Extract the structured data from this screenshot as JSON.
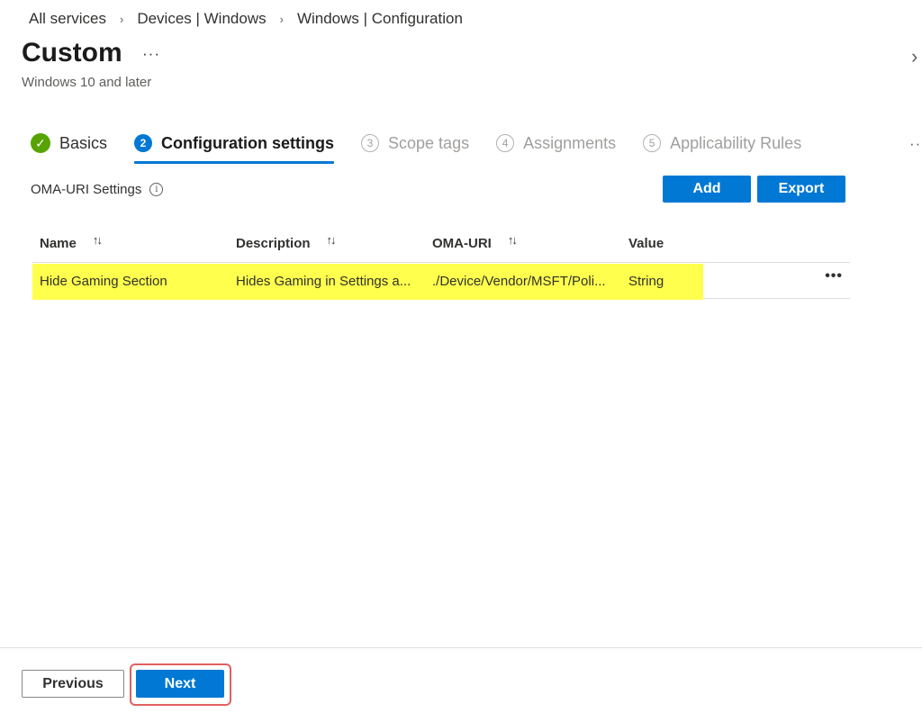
{
  "breadcrumb": [
    "All services",
    "Devices | Windows",
    "Windows | Configuration"
  ],
  "breadcrumb_separator": "›",
  "header": {
    "title": "Custom",
    "more": "···",
    "subtitle": "Windows 10 and later",
    "expand_icon": "›"
  },
  "steps": [
    {
      "number": "",
      "label": "Basics",
      "state": "done"
    },
    {
      "number": "2",
      "label": "Configuration settings",
      "state": "active"
    },
    {
      "number": "3",
      "label": "Scope tags",
      "state": "pending"
    },
    {
      "number": "4",
      "label": "Assignments",
      "state": "pending"
    },
    {
      "number": "5",
      "label": "Applicability Rules",
      "state": "pending"
    }
  ],
  "steps_more": "···",
  "section": {
    "label": "OMA-URI Settings",
    "info_icon": "i"
  },
  "toolbar": {
    "add_label": "Add",
    "export_label": "Export"
  },
  "table": {
    "columns": [
      "Name",
      "Description",
      "OMA-URI",
      "Value"
    ],
    "sort_icon": "↑↓",
    "rows": [
      {
        "name": "Hide Gaming Section",
        "description": "Hides Gaming in Settings a...",
        "oma_uri": "./Device/Vendor/MSFT/Poli...",
        "value": "String",
        "more": "•••"
      }
    ]
  },
  "footer": {
    "previous_label": "Previous",
    "next_label": "Next"
  },
  "colors": {
    "accent": "#0078d4",
    "success": "#57a300",
    "highlight": "#ffff4d",
    "callout": "#e06060"
  }
}
